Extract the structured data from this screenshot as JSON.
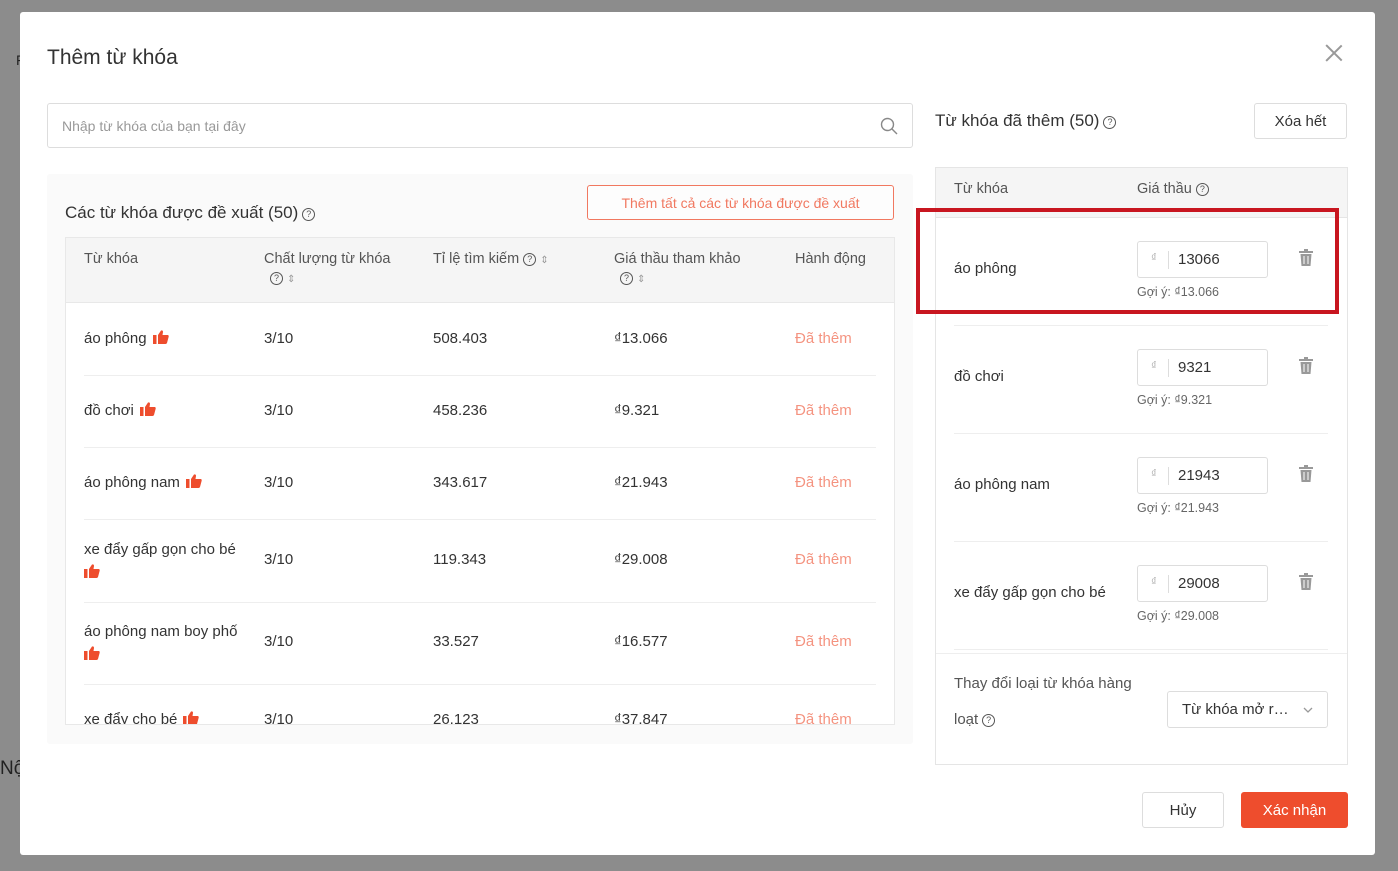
{
  "background": {
    "fragment_1": "F",
    "fragment_2": "Nộ"
  },
  "modal": {
    "title": "Thêm từ khóa",
    "search_placeholder": "Nhập từ khóa của bạn tại đây"
  },
  "suggested": {
    "title": "Các từ khóa được đề xuất (50)",
    "add_all_label": "Thêm tất cả các từ khóa được đề xuất",
    "columns": {
      "keyword": "Từ khóa",
      "quality": "Chất lượng từ khóa",
      "search_rate": "Tỉ lệ tìm kiếm",
      "ref_bid": "Giá thầu tham khảo",
      "action": "Hành động"
    },
    "rows": [
      {
        "keyword": "áo phông",
        "quality": "3/10",
        "search": "508.403",
        "bid": "₫13.066",
        "action": "Đã thêm"
      },
      {
        "keyword": "đồ chơi",
        "quality": "3/10",
        "search": "458.236",
        "bid": "₫9.321",
        "action": "Đã thêm"
      },
      {
        "keyword": "áo phông nam",
        "quality": "3/10",
        "search": "343.617",
        "bid": "₫21.943",
        "action": "Đã thêm"
      },
      {
        "keyword": "xe đẩy gấp gọn cho bé",
        "quality": "3/10",
        "search": "119.343",
        "bid": "₫29.008",
        "action": "Đã thêm"
      },
      {
        "keyword": "áo phông nam boy phố",
        "quality": "3/10",
        "search": "33.527",
        "bid": "₫16.577",
        "action": "Đã thêm"
      },
      {
        "keyword": "xe đẩy cho bé",
        "quality": "3/10",
        "search": "26.123",
        "bid": "₫37.847",
        "action": "Đã thêm"
      }
    ]
  },
  "added": {
    "title": "Từ khóa đã thêm (50)",
    "clear_all_label": "Xóa hết",
    "columns": {
      "keyword": "Từ khóa",
      "bid": "Giá thầu"
    },
    "currency": "₫",
    "rows": [
      {
        "keyword": "áo phông",
        "bid": "13066",
        "hint": "Gợi ý: ₫13.066"
      },
      {
        "keyword": "đồ chơi",
        "bid": "9321",
        "hint": "Gợi ý: ₫9.321"
      },
      {
        "keyword": "áo phông nam",
        "bid": "21943",
        "hint": "Gợi ý: ₫21.943"
      },
      {
        "keyword": "xe đẩy gấp gọn cho bé",
        "bid": "29008",
        "hint": "Gợi ý: ₫29.008"
      }
    ],
    "bulk_label_line1": "Thay đổi loại từ khóa hàng",
    "bulk_label_line2": "loạt",
    "bulk_select_value": "Từ khóa mở rộng"
  },
  "footer": {
    "cancel_label": "Hủy",
    "confirm_label": "Xác nhận"
  },
  "colors": {
    "accent": "#ee4d2d",
    "highlight": "#c81620"
  },
  "icons": {
    "thumb": "thumbs-up-icon",
    "help": "question-circle-icon",
    "trash": "trash-icon",
    "search": "search-icon",
    "close": "close-icon"
  }
}
